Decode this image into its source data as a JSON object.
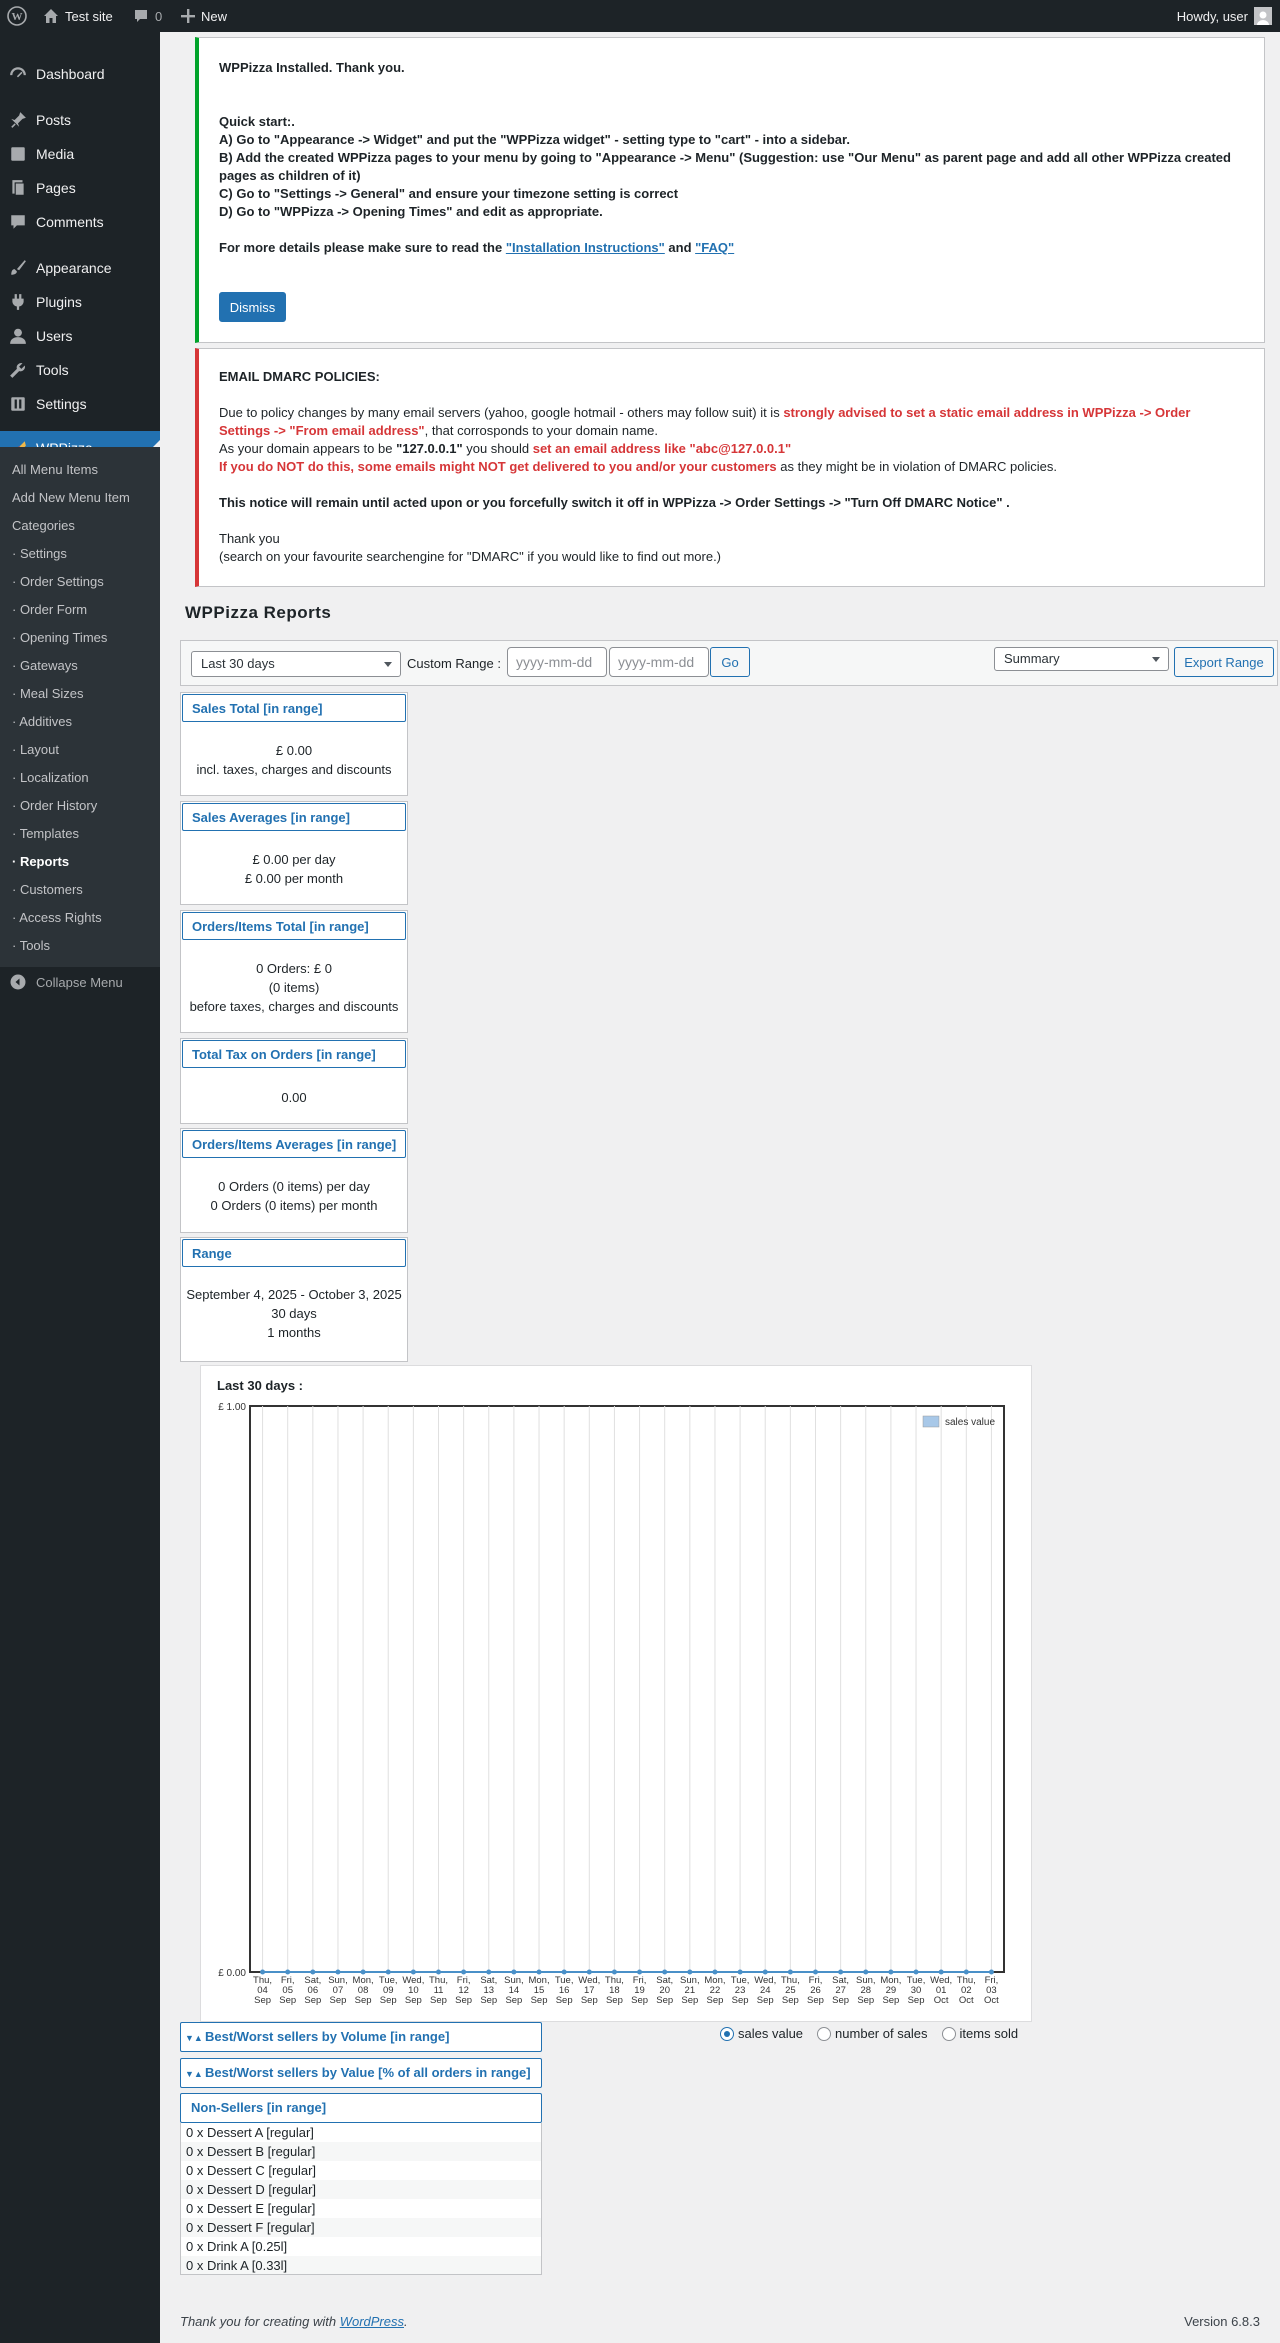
{
  "adminbar": {
    "site_name": "Test site",
    "comments_count": "0",
    "new_label": "New",
    "howdy": "Howdy, user"
  },
  "menu": {
    "items": [
      {
        "label": "Dashboard",
        "icon": "dashboard-icon"
      },
      {
        "label": "Posts",
        "icon": "pin-icon"
      },
      {
        "label": "Media",
        "icon": "media-icon"
      },
      {
        "label": "Pages",
        "icon": "pages-icon"
      },
      {
        "label": "Comments",
        "icon": "comment-icon"
      },
      {
        "label": "Appearance",
        "icon": "brush-icon"
      },
      {
        "label": "Plugins",
        "icon": "plug-icon"
      },
      {
        "label": "Users",
        "icon": "user-icon"
      },
      {
        "label": "Tools",
        "icon": "wrench-icon"
      },
      {
        "label": "Settings",
        "icon": "settings-icon"
      },
      {
        "label": "WPPizza",
        "icon": "pizza-icon"
      }
    ],
    "submenu": [
      "All Menu Items",
      "Add New Menu Item",
      "Categories",
      "· Settings",
      "· Order Settings",
      "· Order Form",
      "· Opening Times",
      "· Gateways",
      "· Meal Sizes",
      "· Additives",
      "· Layout",
      "· Localization",
      "· Order History",
      "· Templates",
      "· Reports",
      "· Customers",
      "· Access Rights",
      "· Tools"
    ],
    "collapse": "Collapse Menu"
  },
  "notice_installed": {
    "title": "WPPizza Installed. Thank you.",
    "quickstart": "Quick start:.",
    "line_a": "A) Go to \"Appearance -> Widget\" and put the \"WPPizza widget\" - setting type to \"cart\" - into a sidebar.",
    "line_b1": "B) Add the created WPPizza pages to your menu by going to \"Appearance -> Menu\" (Suggestion: use \"Our Menu\" as parent page and add all other WPPizza created",
    "line_b2": "pages as children of it)",
    "line_c": "C) Go to \"Settings -> General\" and ensure your timezone setting is correct",
    "line_d": "D) Go to \"WPPizza -> Opening Times\" and edit as appropriate.",
    "details_prefix": "For more details please make sure to read the ",
    "link_install": "\"Installation Instructions\"",
    "and": " and ",
    "link_faq": "\"FAQ\"",
    "dismiss": "Dismiss"
  },
  "notice_dmarc": {
    "title": "EMAIL DMARC POLICIES:",
    "p1_a": "Due to policy changes by many email servers (yahoo, google hotmail - others may follow suit) it is ",
    "p1_red1": "strongly advised to set a static email address in WPPizza -> Order",
    "p1_red2": "Settings -> \"From email address\"",
    "p1_b": ", that corrosponds to your domain name.",
    "p2_a": "As your domain appears to be ",
    "p2_domain": "\"127.0.0.1\"",
    "p2_b": " you should ",
    "p2_red": "set an email address like \"abc@127.0.0.1\"",
    "p3_red": "If you do NOT do this, some emails might NOT get delivered to you and/or your customers",
    "p3_b": " as they might be in violation of DMARC policies.",
    "p4": "This notice will remain until acted upon or you forcefully switch it off in WPPizza -> Order Settings -> \"Turn Off DMARC Notice\" .",
    "thanks": "Thank you",
    "search": "(search on your favourite searchengine for \"DMARC\" if you would like to find out more.)"
  },
  "page_title": "WPPizza Reports",
  "toolbar": {
    "range_select": "Last 30 days",
    "custom_range": "Custom Range :",
    "from_placeholder": "yyyy-mm-dd",
    "to_placeholder": "yyyy-mm-dd",
    "go": "Go",
    "report_select": "Summary",
    "export": "Export Range"
  },
  "boxes": {
    "sales_total": {
      "title": "Sales Total [in range]",
      "l1": "£ 0.00",
      "l2": "incl. taxes, charges and discounts"
    },
    "sales_avg": {
      "title": "Sales Averages [in range]",
      "l1": "£ 0.00 per day",
      "l2": "£ 0.00 per month"
    },
    "orders_total": {
      "title": "Orders/Items Total [in range]",
      "l1": "0 Orders: £ 0",
      "l2": "(0 items)",
      "l3": "before taxes, charges and discounts"
    },
    "tax": {
      "title": "Total Tax on Orders [in range]",
      "l1": "0.00"
    },
    "orders_avg": {
      "title": "Orders/Items Averages [in range]",
      "l1": "0 Orders (0 items) per day",
      "l2": "0 Orders (0 items) per month"
    },
    "range": {
      "title": "Range",
      "l1": "September 4, 2025 - October 3, 2025",
      "l2": "30 days",
      "l3": "1 months"
    }
  },
  "chart_title": "Last 30 days :",
  "chart_data": {
    "type": "area",
    "ylim": [
      0,
      1
    ],
    "y_ticks": [
      "£ 0.00",
      "£ 1.00"
    ],
    "legend": "sales value",
    "legend_position": "top-right",
    "grid": true,
    "series_color": "#a8c8e8",
    "x": [
      [
        "Thu,",
        "04",
        "Sep"
      ],
      [
        "Fri,",
        "05",
        "Sep"
      ],
      [
        "Sat,",
        "06",
        "Sep"
      ],
      [
        "Sun,",
        "07",
        "Sep"
      ],
      [
        "Mon,",
        "08",
        "Sep"
      ],
      [
        "Tue,",
        "09",
        "Sep"
      ],
      [
        "Wed,",
        "10",
        "Sep"
      ],
      [
        "Thu,",
        "11",
        "Sep"
      ],
      [
        "Fri,",
        "12",
        "Sep"
      ],
      [
        "Sat,",
        "13",
        "Sep"
      ],
      [
        "Sun,",
        "14",
        "Sep"
      ],
      [
        "Mon,",
        "15",
        "Sep"
      ],
      [
        "Tue,",
        "16",
        "Sep"
      ],
      [
        "Wed,",
        "17",
        "Sep"
      ],
      [
        "Thu,",
        "18",
        "Sep"
      ],
      [
        "Fri,",
        "19",
        "Sep"
      ],
      [
        "Sat,",
        "20",
        "Sep"
      ],
      [
        "Sun,",
        "21",
        "Sep"
      ],
      [
        "Mon,",
        "22",
        "Sep"
      ],
      [
        "Tue,",
        "23",
        "Sep"
      ],
      [
        "Wed,",
        "24",
        "Sep"
      ],
      [
        "Thu,",
        "25",
        "Sep"
      ],
      [
        "Fri,",
        "26",
        "Sep"
      ],
      [
        "Sat,",
        "27",
        "Sep"
      ],
      [
        "Sun,",
        "28",
        "Sep"
      ],
      [
        "Mon,",
        "29",
        "Sep"
      ],
      [
        "Tue,",
        "30",
        "Sep"
      ],
      [
        "Wed,",
        "01",
        "Oct"
      ],
      [
        "Thu,",
        "02",
        "Oct"
      ],
      [
        "Fri,",
        "03",
        "Oct"
      ]
    ],
    "series": [
      {
        "name": "sales value",
        "values": [
          0,
          0,
          0,
          0,
          0,
          0,
          0,
          0,
          0,
          0,
          0,
          0,
          0,
          0,
          0,
          0,
          0,
          0,
          0,
          0,
          0,
          0,
          0,
          0,
          0,
          0,
          0,
          0,
          0,
          0
        ]
      }
    ]
  },
  "chart_options": [
    "sales value",
    "number of sales",
    "items sold"
  ],
  "accordions": {
    "volume": "Best/Worst sellers by Volume [in range]",
    "value": "Best/Worst sellers by Value [% of all orders in range]",
    "nonsellers": "Non-Sellers [in range]"
  },
  "nonsellers": [
    "0 x Dessert A [regular]",
    "0 x Dessert B [regular]",
    "0 x Dessert C [regular]",
    "0 x Dessert D [regular]",
    "0 x Dessert E [regular]",
    "0 x Dessert F [regular]",
    "0 x Drink A [0.25l]",
    "0 x Drink A [0.33l]"
  ],
  "footer": {
    "thanks": "Thank you for creating with ",
    "wp": "WordPress",
    "dot": ".",
    "version": "Version 6.8.3"
  }
}
